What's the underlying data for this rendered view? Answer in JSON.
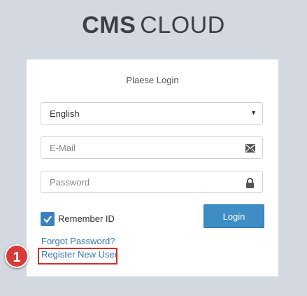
{
  "brand": {
    "strong": "CMS",
    "light": "CLOUD"
  },
  "login_card": {
    "title": "Plaese Login",
    "language_select": {
      "value": "English",
      "caret_icon": "chevron-down-icon"
    },
    "email_field": {
      "placeholder": "E-Mail",
      "icon": "envelope-icon"
    },
    "password_field": {
      "placeholder": "Password",
      "icon": "lock-icon"
    },
    "remember": {
      "label": "Remember ID",
      "checked": true
    },
    "login_button": "Login",
    "forgot_password_link": "Forgot Password?",
    "register_link": "Register New User"
  },
  "annotation": {
    "step_number": "1",
    "highlight_color": "#d12d2d"
  },
  "colors": {
    "background": "#d4d9e1",
    "accent": "#3e8dc5",
    "link": "#3a79b5"
  }
}
